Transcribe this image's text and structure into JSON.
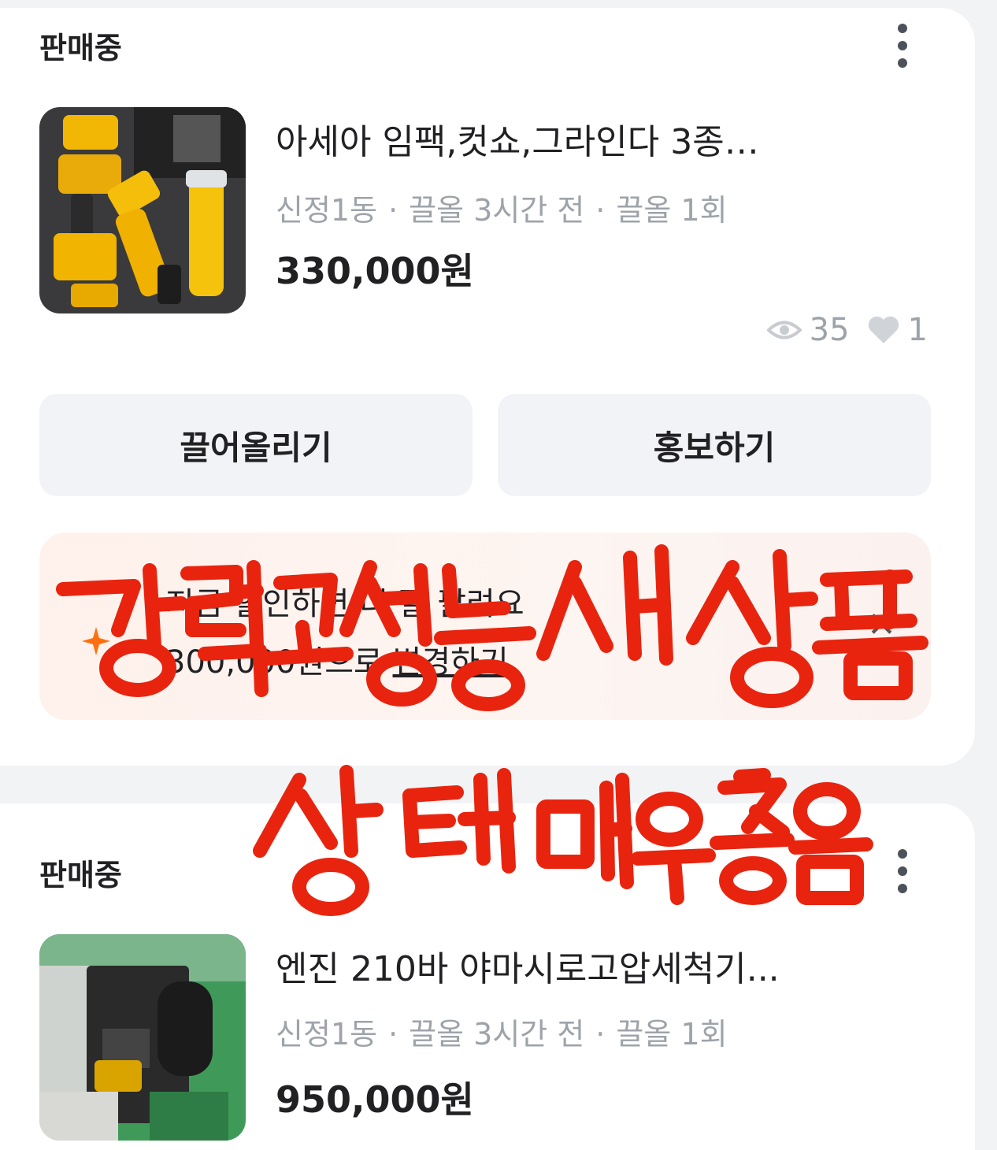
{
  "listings": [
    {
      "status": "판매중",
      "title": "아세아 임팩,컷쇼,그라인다 3종…",
      "location": "신정1동",
      "bump_time": "끌올 3시간 전",
      "bump_count": "끌올 1회",
      "separator": "·",
      "price": "330,000원",
      "views": "35",
      "likes": "1",
      "image_icon": "power-tools-photo"
    },
    {
      "status": "판매중",
      "title": "엔진 210바 야마시로고압세척기...",
      "location": "신정1동",
      "bump_time": "끌올 3시간 전",
      "bump_count": "끌올 1회",
      "separator": "·",
      "price": "950,000원",
      "image_icon": "pressure-washer-photo"
    }
  ],
  "actions": {
    "bump": "끌어올리기",
    "promote": "홍보하기"
  },
  "promo": {
    "title": "지금 할인하면 더 잘 팔려요",
    "price_text": "300,000원으로",
    "change_link": "변경하기",
    "close_icon": "close-icon",
    "sparkle_icon": "sparkle-icon"
  },
  "handwriting_overlay": {
    "line1": "강력고성능 새상품",
    "line2": "상태 매우좋음",
    "color": "#e8240f"
  }
}
